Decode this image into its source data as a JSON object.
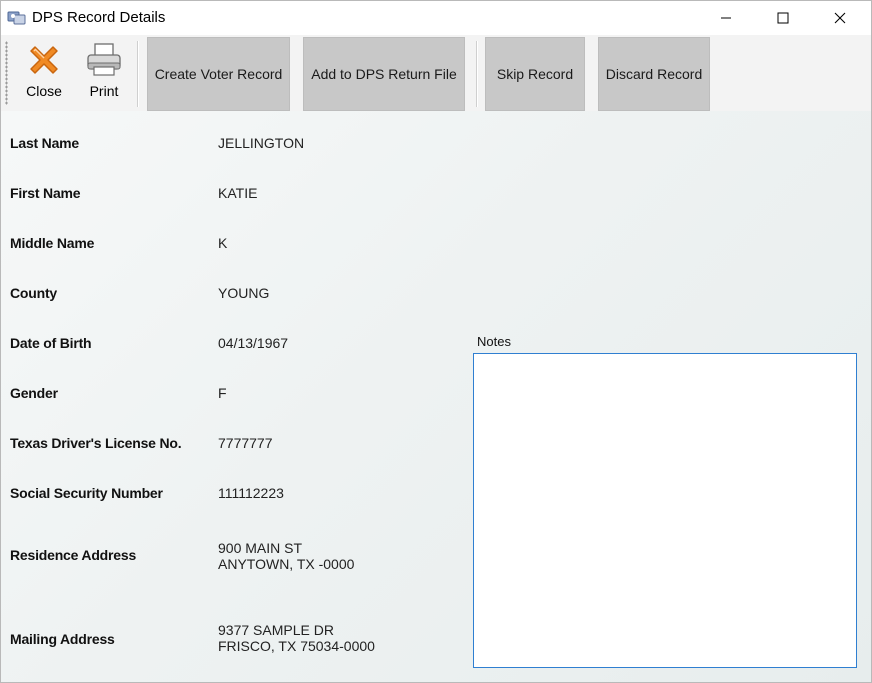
{
  "window": {
    "title": "DPS Record Details"
  },
  "toolbar": {
    "close_label": "Close",
    "print_label": "Print",
    "create_voter_label": "Create Voter Record",
    "add_dps_label": "Add to DPS Return File",
    "skip_label": "Skip Record",
    "discard_label": "Discard Record"
  },
  "fields": {
    "last_name": {
      "label": "Last Name",
      "value": "JELLINGTON"
    },
    "first_name": {
      "label": "First Name",
      "value": "KATIE"
    },
    "middle_name": {
      "label": "Middle Name",
      "value": "K"
    },
    "county": {
      "label": "County",
      "value": "YOUNG"
    },
    "dob": {
      "label": "Date of Birth",
      "value": "04/13/1967"
    },
    "gender": {
      "label": "Gender",
      "value": "F"
    },
    "dl": {
      "label": "Texas Driver's License No.",
      "value": "7777777"
    },
    "ssn": {
      "label": "Social Security Number",
      "value": "111112223"
    },
    "residence": {
      "label": "Residence Address",
      "line1": "900 MAIN ST",
      "line2": "ANYTOWN, TX -0000"
    },
    "mailing": {
      "label": "Mailing Address",
      "line1": "9377 SAMPLE DR",
      "line2": "FRISCO, TX 75034-0000"
    }
  },
  "notes": {
    "label": "Notes",
    "value": ""
  },
  "colors": {
    "action_button_bg": "#c8c8c8",
    "notes_border": "#2f7fd1",
    "close_icon": "#f08a24"
  }
}
